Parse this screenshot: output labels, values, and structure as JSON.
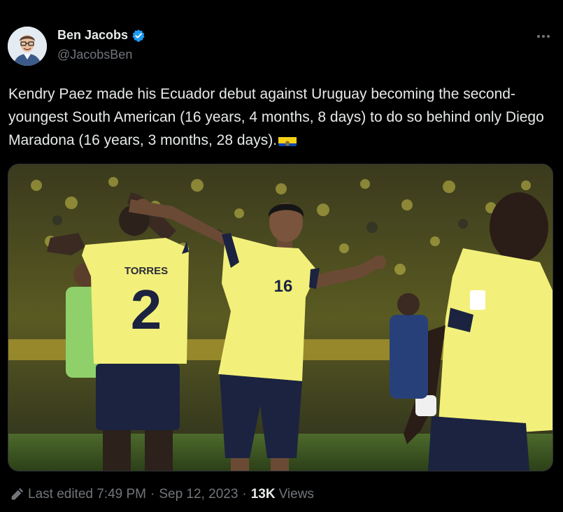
{
  "author": {
    "display_name": "Ben Jacobs",
    "handle": "@JacobsBen",
    "verified_color": "#1d9bf0"
  },
  "more_icon": "more-horizontal-icon",
  "tweet": {
    "text": "Kendry Paez made his Ecuador debut against Uruguay becoming the second-youngest South American (16 years, 4 months, 8 days) to do so behind only Diego Maradona (16 years, 3 months, 28 days).",
    "emoji": "ecuador-flag"
  },
  "media": {
    "players": [
      {
        "shirt_name": "TORRES",
        "shirt_number": "2"
      },
      {
        "shirt_number": "16"
      }
    ]
  },
  "footer": {
    "edited_label": "Last edited",
    "time": "7:49 PM",
    "separator": "·",
    "date": "Sep 12, 2023",
    "views_count": "13K",
    "views_label": "Views"
  },
  "colors": {
    "background": "#000000",
    "text": "#e7e9ea",
    "secondary": "#71767b",
    "kit_yellow": "#f2f07a",
    "kit_navy": "#1b2340"
  }
}
